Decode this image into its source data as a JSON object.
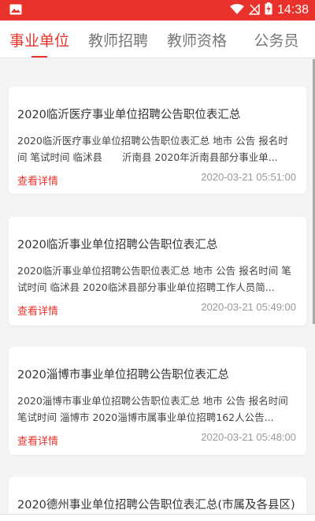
{
  "status_bar": {
    "time": "14:38",
    "icons": [
      "image-icon",
      "wifi-icon",
      "no-signal-icon",
      "battery-charging-icon"
    ],
    "background": "#e8322b"
  },
  "tabs": [
    {
      "label": "事业单位",
      "active": true
    },
    {
      "label": "教师招聘",
      "active": false
    },
    {
      "label": "教师资格",
      "active": false
    },
    {
      "label": "公务员",
      "active": false
    }
  ],
  "accent_color": "#e8322b",
  "articles": [
    {
      "title": "2020临沂医疗事业单位招聘公告职位表汇总",
      "summary": "2020临沂医疗事业单位招聘公告职位表汇总 地市 公告 报名时间 笔试时间 临沭县　　沂南县 2020年沂南县部分事业单...",
      "detail_link": "查看详情",
      "date": "2020-03-21 05:51:00"
    },
    {
      "title": "2020临沂事业单位招聘公告职位表汇总",
      "summary": "2020临沂事业单位招聘公告职位表汇总 地市 公告 报名时间 笔试时间 临沭县 2020临沭县部分事业单位招聘工作人员简...",
      "detail_link": "查看详情",
      "date": "2020-03-21 05:49:00"
    },
    {
      "title": "2020淄博市事业单位招聘公告职位表汇总",
      "summary": "2020淄博市事业单位招聘公告职位表汇总 地市 公告 报名时间 笔试时间 淄博市 2020淄博市属事业单位招聘162人公告...",
      "detail_link": "查看详情",
      "date": "2020-03-21 05:48:00"
    },
    {
      "title": "2020德州事业单位招聘公告职位表汇总(市属及各县区)"
    }
  ]
}
